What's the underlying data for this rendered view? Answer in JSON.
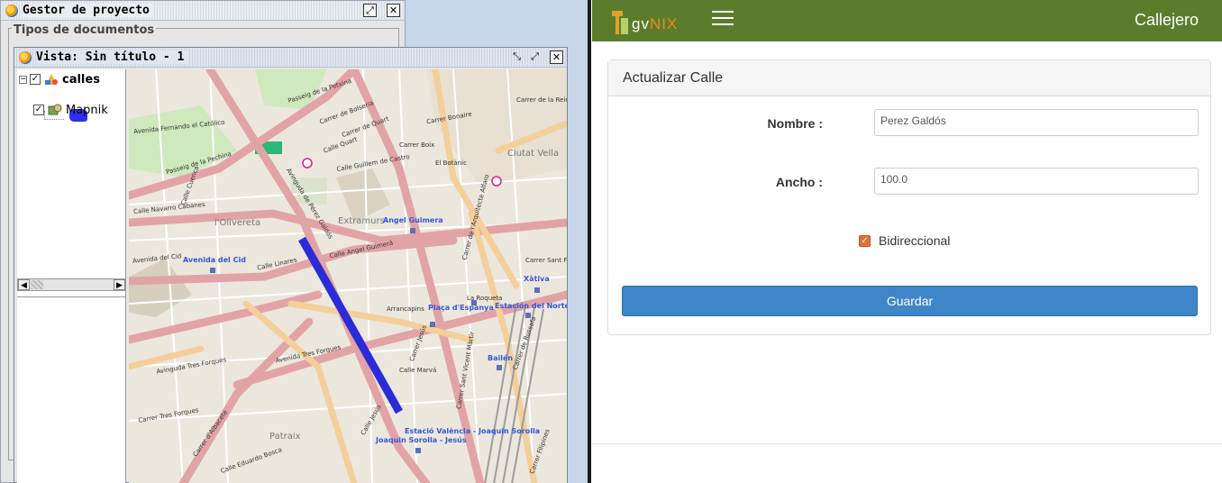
{
  "project_manager": {
    "title": "Gestor de proyecto",
    "section_label": "Tipos de documentos"
  },
  "view_window": {
    "title": "Vista: Sin título - 1",
    "layers": [
      {
        "name": "calles",
        "checked": true,
        "expanded": true
      },
      {
        "name": "Mapnik",
        "checked": true
      }
    ],
    "expand_symbol": "−",
    "check_symbol": "✓"
  },
  "map": {
    "labels": [
      "Passeig de la Petxina",
      "Passeig de la Pechina",
      "Avenida Fernando el Católico",
      "Calle Cuenca",
      "Calle Quart",
      "Calle Guillem de Castro",
      "Carrer de Quart",
      "Carrer Boix",
      "Carrer Bonaire",
      "Carrer de Bolseria",
      "Ciutat Vella",
      "El Botànic",
      "l'Olivereta",
      "Extramurs",
      "Calle Angel Guimerá",
      "Calle Linares",
      "Avenida del Cid",
      "Avenida Tres Forques",
      "Avinguda Tres Forques",
      "Avinguda de Pérez Galdós",
      "Carrer de l'Arquitecte Alfaro",
      "Carrer Sant Vicent Màrtir",
      "Carrer Jesús",
      "Calle Jesús",
      "La Roqueta",
      "Patraix",
      "Arrancapins",
      "Carrer de Russafa",
      "Calle Marvá",
      "Carrer Filipines",
      "Carrer Tres Forques",
      "Calle Navarro Cabanes",
      "Carrer d'Albacete",
      "Carrer Sant Francesc",
      "Carrer de la Reina",
      "Calle Eduardo Bosca"
    ],
    "poi": [
      "Angel Guimera",
      "Avenida del Cid",
      "Xàtiva",
      "Plaça d'Espanya",
      "Estación del Norte",
      "Bailén",
      "Estació València - Joaquin Sorolla",
      "Joaquin Sorolla - Jesús"
    ],
    "highlight_color": "#2b2bd8"
  },
  "webapp": {
    "brand_prefix": "gv",
    "brand_suffix": "NIX",
    "title": "Callejero",
    "panel_title": "Actualizar Calle",
    "fields": {
      "nombre_label": "Nombre :",
      "nombre_value": "Perez Galdós",
      "ancho_label": "Ancho :",
      "ancho_value": "100.0",
      "bidireccional_label": "Bidireccional",
      "bidireccional_checked": true
    },
    "save_label": "Guardar",
    "colors": {
      "navbar": "#5b7d2b",
      "primary": "#3f86c8",
      "brand_accent": "#f08a1c"
    }
  }
}
